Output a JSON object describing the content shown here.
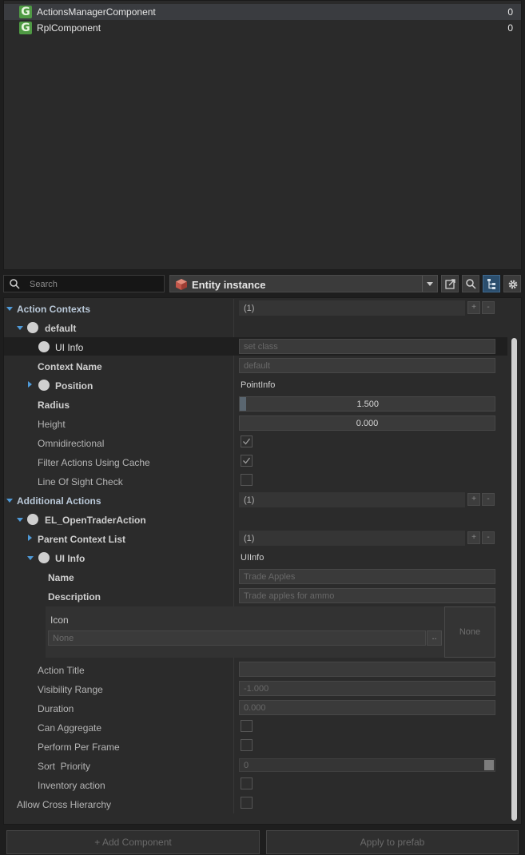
{
  "components": {
    "items": [
      {
        "name": "ActionsManagerComponent",
        "count": "0",
        "icon": "G"
      },
      {
        "name": "RplComponent",
        "count": "0",
        "icon": "G"
      }
    ]
  },
  "toolbar": {
    "search_placeholder": "Search",
    "entity_label": "Entity instance"
  },
  "properties": {
    "action_contexts_label": "Action Contexts",
    "action_contexts_value": "(1)",
    "default_label": "default",
    "ui_info_label": "UI Info",
    "ui_info_placeholder": "set class",
    "context_name_label": "Context Name",
    "context_name_value": "default",
    "position_label": "Position",
    "position_value": "PointInfo",
    "radius_label": "Radius",
    "radius_value": "1.500",
    "height_label": "Height",
    "height_value": "0.000",
    "omnidirectional_label": "Omnidirectional",
    "filter_actions_label": "Filter Actions Using Cache",
    "line_of_sight_label": "Line Of Sight Check",
    "additional_actions_label": "Additional Actions",
    "additional_actions_value": "(1)",
    "trader_action_label": "EL_OpenTraderAction",
    "parent_context_label": "Parent Context List",
    "parent_context_value": "(1)",
    "ui_info2_label": "UI Info",
    "ui_info2_value": "UIInfo",
    "name_label": "Name",
    "name_value": "Trade Apples",
    "description_label": "Description",
    "description_value": "Trade apples for ammo",
    "icon_label": "Icon",
    "icon_placeholder": "None",
    "icon_browse": "..",
    "icon_preview": "None",
    "action_title_label": "Action Title",
    "visibility_range_label": "Visibility Range",
    "visibility_range_value": "-1.000",
    "duration_label": "Duration",
    "duration_value": "0.000",
    "can_aggregate_label": "Can Aggregate",
    "perform_per_frame_label": "Perform Per Frame",
    "sort_priority_label": "Sort  Priority",
    "sort_priority_value": "0",
    "inventory_action_label": "Inventory action",
    "allow_cross_label": "Allow Cross Hierarchy",
    "array_add": "+",
    "array_remove": "-"
  },
  "buttons": {
    "add_component": "+ Add Component",
    "apply_prefab": "Apply to prefab"
  },
  "colors": {
    "accent_blue": "#4f9ad8",
    "component_icon_green": "#4f9a44",
    "selected_tool": "#2b4e6d"
  }
}
